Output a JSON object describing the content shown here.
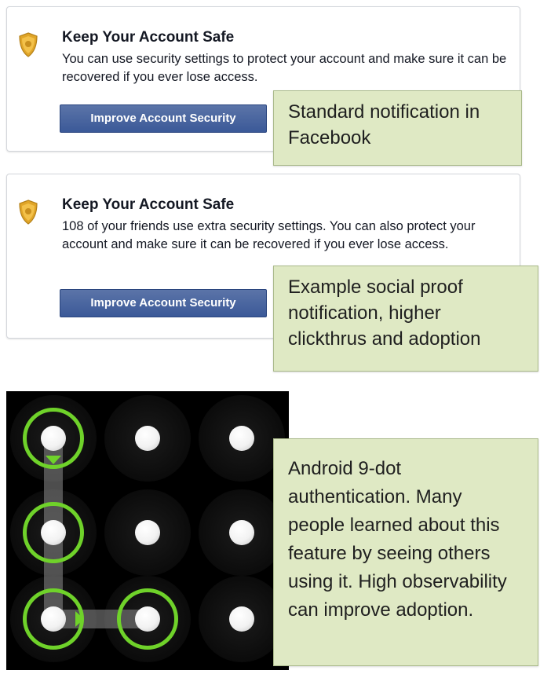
{
  "cards": [
    {
      "title": "Keep Your Account Safe",
      "body": "You can use security settings to protect your account and make sure it can be recovered if you ever lose access.",
      "button_label": "Improve Account Security",
      "icon": "shield-icon"
    },
    {
      "title": "Keep Your Account Safe",
      "body": "108 of your friends use extra security settings. You can also protect your account and make sure it can be recovered if you ever lose access.",
      "button_label": "Improve Account Security",
      "icon": "shield-icon"
    }
  ],
  "callouts": {
    "standard": "Standard notification in Facebook",
    "social_proof": "Example social proof notification, higher clickthrus and adoption",
    "android": "Android 9-dot authentication. Many people learned about this feature by seeing others using it. High observability can improve adoption."
  },
  "pattern_lock": {
    "grid": "3x3",
    "selected_nodes": [
      1,
      4,
      7,
      8
    ],
    "colors": {
      "ring": "#6fd22a",
      "background": "#000000"
    }
  },
  "colors": {
    "fb_button": "#3b5998",
    "callout_bg": "#dfe9c4",
    "shield": "#e0a528"
  }
}
